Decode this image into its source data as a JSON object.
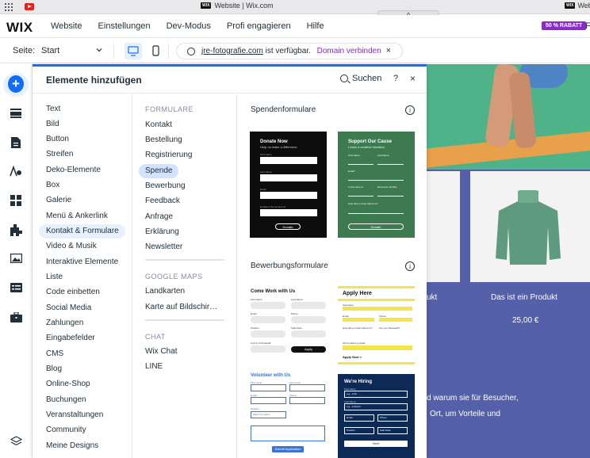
{
  "browser": {
    "tab_title": "Website | Wix.com",
    "tab_right": "WIX",
    "tab_right_extra": "Website",
    "handle_glyph": "^"
  },
  "topbar": {
    "logo": "WIX",
    "menu": [
      "Website",
      "Einstellungen",
      "Dev-Modus",
      "Profi engagieren",
      "Hilfe"
    ],
    "discount_badge": "50 % RABATT",
    "overflow": "F"
  },
  "subbar": {
    "page_label": "Seite:",
    "page_value": "Start",
    "domain_link": "jre-fotografie.com",
    "domain_status": "ist verfügbar.",
    "domain_connect": "Domain verbinden",
    "close_glyph": "×"
  },
  "panel": {
    "title": "Elemente hinzufügen",
    "search_label": "Suchen",
    "help_glyph": "?",
    "close_glyph": "×",
    "categories": [
      "Text",
      "Bild",
      "Button",
      "Streifen",
      "Deko-Elemente",
      "Box",
      "Galerie",
      "Menü & Ankerlink",
      "Kontakt & Formulare",
      "Video & Musik",
      "Interaktive Elemente",
      "Liste",
      "Code einbetten",
      "Social Media",
      "Zahlungen",
      "Eingabefelder",
      "CMS",
      "Blog",
      "Online-Shop",
      "Buchungen",
      "Veranstaltungen",
      "Community",
      "Meine Designs"
    ],
    "active_category": "Kontakt & Formulare",
    "sections": [
      {
        "title": "FORMULARE",
        "items": [
          "Kontakt",
          "Bestellung",
          "Registrierung",
          "Spende",
          "Bewerbung",
          "Feedback",
          "Anfrage",
          "Erklärung",
          "Newsletter"
        ]
      },
      {
        "title": "GOOGLE MAPS",
        "items": [
          "Landkarten",
          "Karte auf Bildschir…"
        ]
      },
      {
        "title": "CHAT",
        "items": [
          "Wix Chat",
          "LINE"
        ]
      }
    ],
    "active_item": "Spende",
    "groups": [
      {
        "title": "Spendenformulare"
      },
      {
        "title": "Bewerbungsformulare"
      }
    ],
    "info_glyph": "i"
  },
  "thumbs": {
    "donate_now": {
      "title": "Donate Now",
      "subtitle": "Help us make a difference.",
      "labels": [
        "First Name",
        "Last Name",
        "Email",
        "Donate in the amount of"
      ],
      "button": "Donate",
      "bg": "#0d0d0d"
    },
    "support_cause": {
      "title": "Support Our Cause",
      "subtitle": "Leave a creative donation",
      "labels": [
        "First Name",
        "Last Name",
        "Email*",
        "In the name of",
        "Recurrent monthly",
        "How did you hear about us?"
      ],
      "button": "Donate",
      "bg": "#3e7a4f"
    },
    "work_with_us": {
      "title": "Come Work with Us",
      "labels": [
        "First Name",
        "Last Name",
        "Email",
        "Phone",
        "Position",
        "Start Date",
        "Link to CV/LinkedIn"
      ],
      "button": "Apply"
    },
    "apply_here": {
      "title": "Apply Here",
      "labels": [
        "Username",
        "Email",
        "Phone",
        "How did you hear about us?",
        "Are you interested?",
        "Tell us about yourself"
      ],
      "button": "Apply Now >",
      "accent": "#f4e54c"
    },
    "volunteer": {
      "title": "Volunteer with Us",
      "labels": [
        "First name",
        "Last name",
        "Email",
        "Phone",
        "Position",
        "Select an option"
      ],
      "button": "Submit Application",
      "accent": "#3a72d6"
    },
    "hiring": {
      "title": "We're Hiring",
      "labels": [
        "First Name",
        "Last Name",
        "Email",
        "Phone",
        "Position",
        "Start Date"
      ],
      "placeholders": [
        "e.g., John",
        "e.g., Johnson"
      ],
      "button": "Next",
      "bg": "#0d2a57"
    }
  },
  "canvas": {
    "product_a": "ukt",
    "product_b": "Das ist ein Produkt",
    "price": "25,00 €",
    "text_line1": "d warum sie für Besucher,",
    "text_line2": "Ort, um Vorteile und"
  },
  "colors": {
    "accent": "#116dff",
    "purple": "#8a2cc8",
    "canvas_blue": "#5460a8"
  }
}
